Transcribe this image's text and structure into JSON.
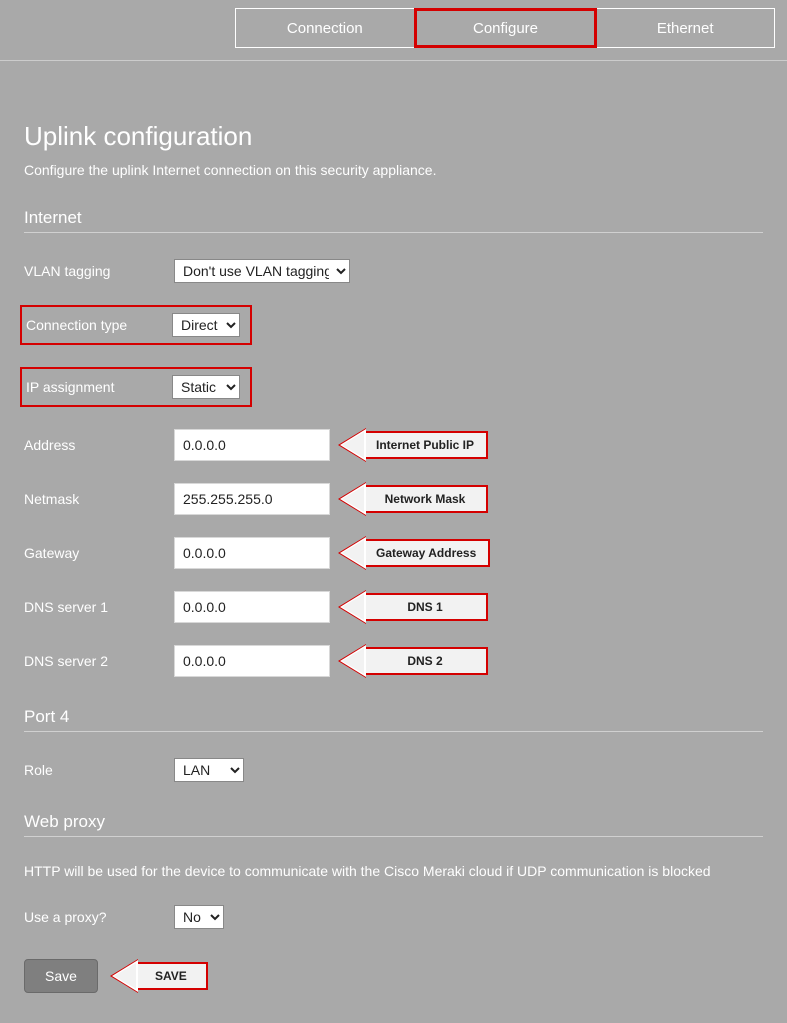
{
  "tabs": {
    "connection": "Connection",
    "configure": "Configure",
    "ethernet": "Ethernet"
  },
  "page": {
    "title": "Uplink configuration",
    "desc": "Configure the uplink Internet connection on this security appliance."
  },
  "internet": {
    "heading": "Internet",
    "vlan_label": "VLAN tagging",
    "vlan_value": "Don't use VLAN tagging",
    "conn_label": "Connection type",
    "conn_value": "Direct",
    "ip_label": "IP assignment",
    "ip_value": "Static",
    "address_label": "Address",
    "address_value": "0.0.0.0",
    "address_hint": "Internet Public IP",
    "netmask_label": "Netmask",
    "netmask_value": "255.255.255.0",
    "netmask_hint": "Network Mask",
    "gateway_label": "Gateway",
    "gateway_value": "0.0.0.0",
    "gateway_hint": "Gateway Address",
    "dns1_label": "DNS server 1",
    "dns1_value": "0.0.0.0",
    "dns1_hint": "DNS 1",
    "dns2_label": "DNS server 2",
    "dns2_value": "0.0.0.0",
    "dns2_hint": "DNS 2"
  },
  "port4": {
    "heading": "Port 4",
    "role_label": "Role",
    "role_value": "LAN"
  },
  "proxy": {
    "heading": "Web proxy",
    "desc": "HTTP will be used for the device to communicate with the Cisco Meraki cloud if UDP communication is blocked",
    "use_label": "Use a proxy?",
    "use_value": "No"
  },
  "save": {
    "button": "Save",
    "hint": "SAVE"
  }
}
